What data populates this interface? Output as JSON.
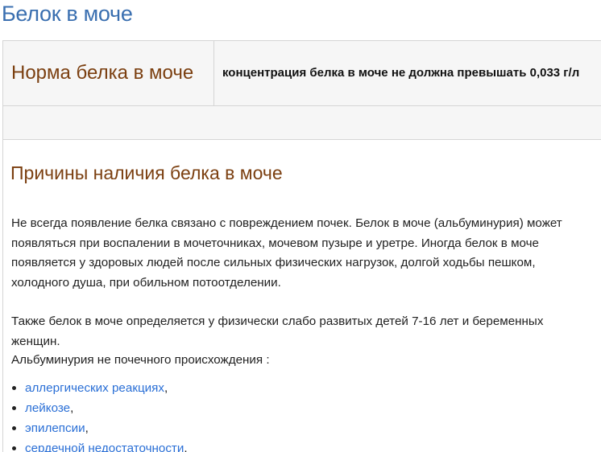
{
  "page": {
    "title": "Белок в моче"
  },
  "norm_table": {
    "heading": "Норма белка в моче",
    "value": "концентрация белка в моче не должна превышать 0,033 г/л"
  },
  "causes": {
    "heading": "Причины наличия белка в моче",
    "paragraph1": "Не всегда появление белка связано с повреждением почек. Белок в моче (альбуминурия) может появляться при воспалении в мочеточниках, мочевом пузыре и уретре. Иногда белок в моче появляется у здоровых людей после сильных физических нагрузок, долгой ходьбы пешком, холодного душа, при обильном потоотделении.",
    "paragraph2": "Также белок в моче определяется у физически слабо развитых детей 7-16 лет и беременных женщин.",
    "paragraph3": "Альбуминурия не почечного происхождения :",
    "items": [
      {
        "link": "аллергических реакциях",
        "suffix": ","
      },
      {
        "link": "лейкозе",
        "suffix": ","
      },
      {
        "link": "эпилепсии",
        "suffix": ","
      },
      {
        "link": "сердечной недостаточности",
        "suffix": "."
      }
    ]
  },
  "colors": {
    "title": "#3a6fb0",
    "heading": "#7b3f10",
    "link": "#2a6fd6",
    "table_bg": "#f6f6f6"
  }
}
